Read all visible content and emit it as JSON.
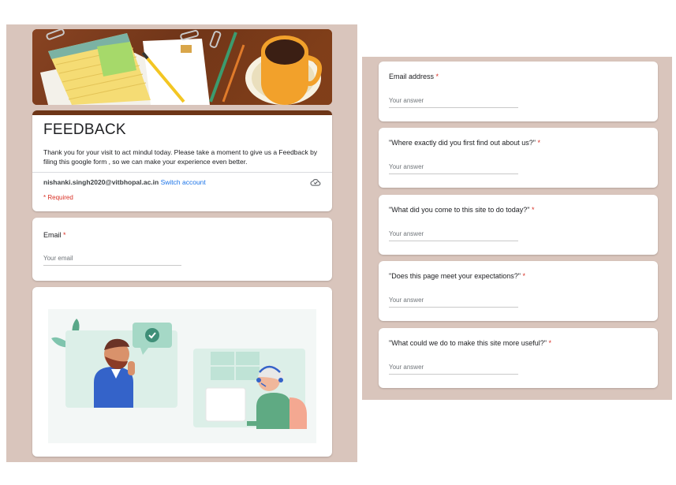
{
  "form": {
    "title": "FEEDBACK",
    "description": "Thank you for your visit to act mindul today. Please take a moment to give us a Feedback by filing this google form , so we can make your experience even better.",
    "account_email": "nishanki.singh2020@vitbhopal.ac.in",
    "switch_account": "Switch account",
    "required_note": "* Required"
  },
  "left_questions": [
    {
      "label": "Email",
      "placeholder": "Your email",
      "required": true
    }
  ],
  "right_questions": [
    {
      "label": "Email address",
      "placeholder": "Your answer",
      "required": true
    },
    {
      "label": "\"Where exactly did you first find out about us?\"",
      "placeholder": "Your answer",
      "required": true
    },
    {
      "label": "\"What did you come to this site to do today?\"",
      "placeholder": "Your answer",
      "required": true
    },
    {
      "label": "\"Does this page meet your expectations?\"",
      "placeholder": "Your answer",
      "required": true
    },
    {
      "label": "\"What could we do to make this site more useful?\"",
      "placeholder": "Your answer",
      "required": true
    }
  ],
  "icons": {
    "cloud": "cloud-save-icon",
    "check": "check-icon"
  },
  "colors": {
    "page_bg": "#d9c5bc",
    "header_accent": "#6d3517",
    "required": "#d93025",
    "link": "#1a73e8"
  }
}
